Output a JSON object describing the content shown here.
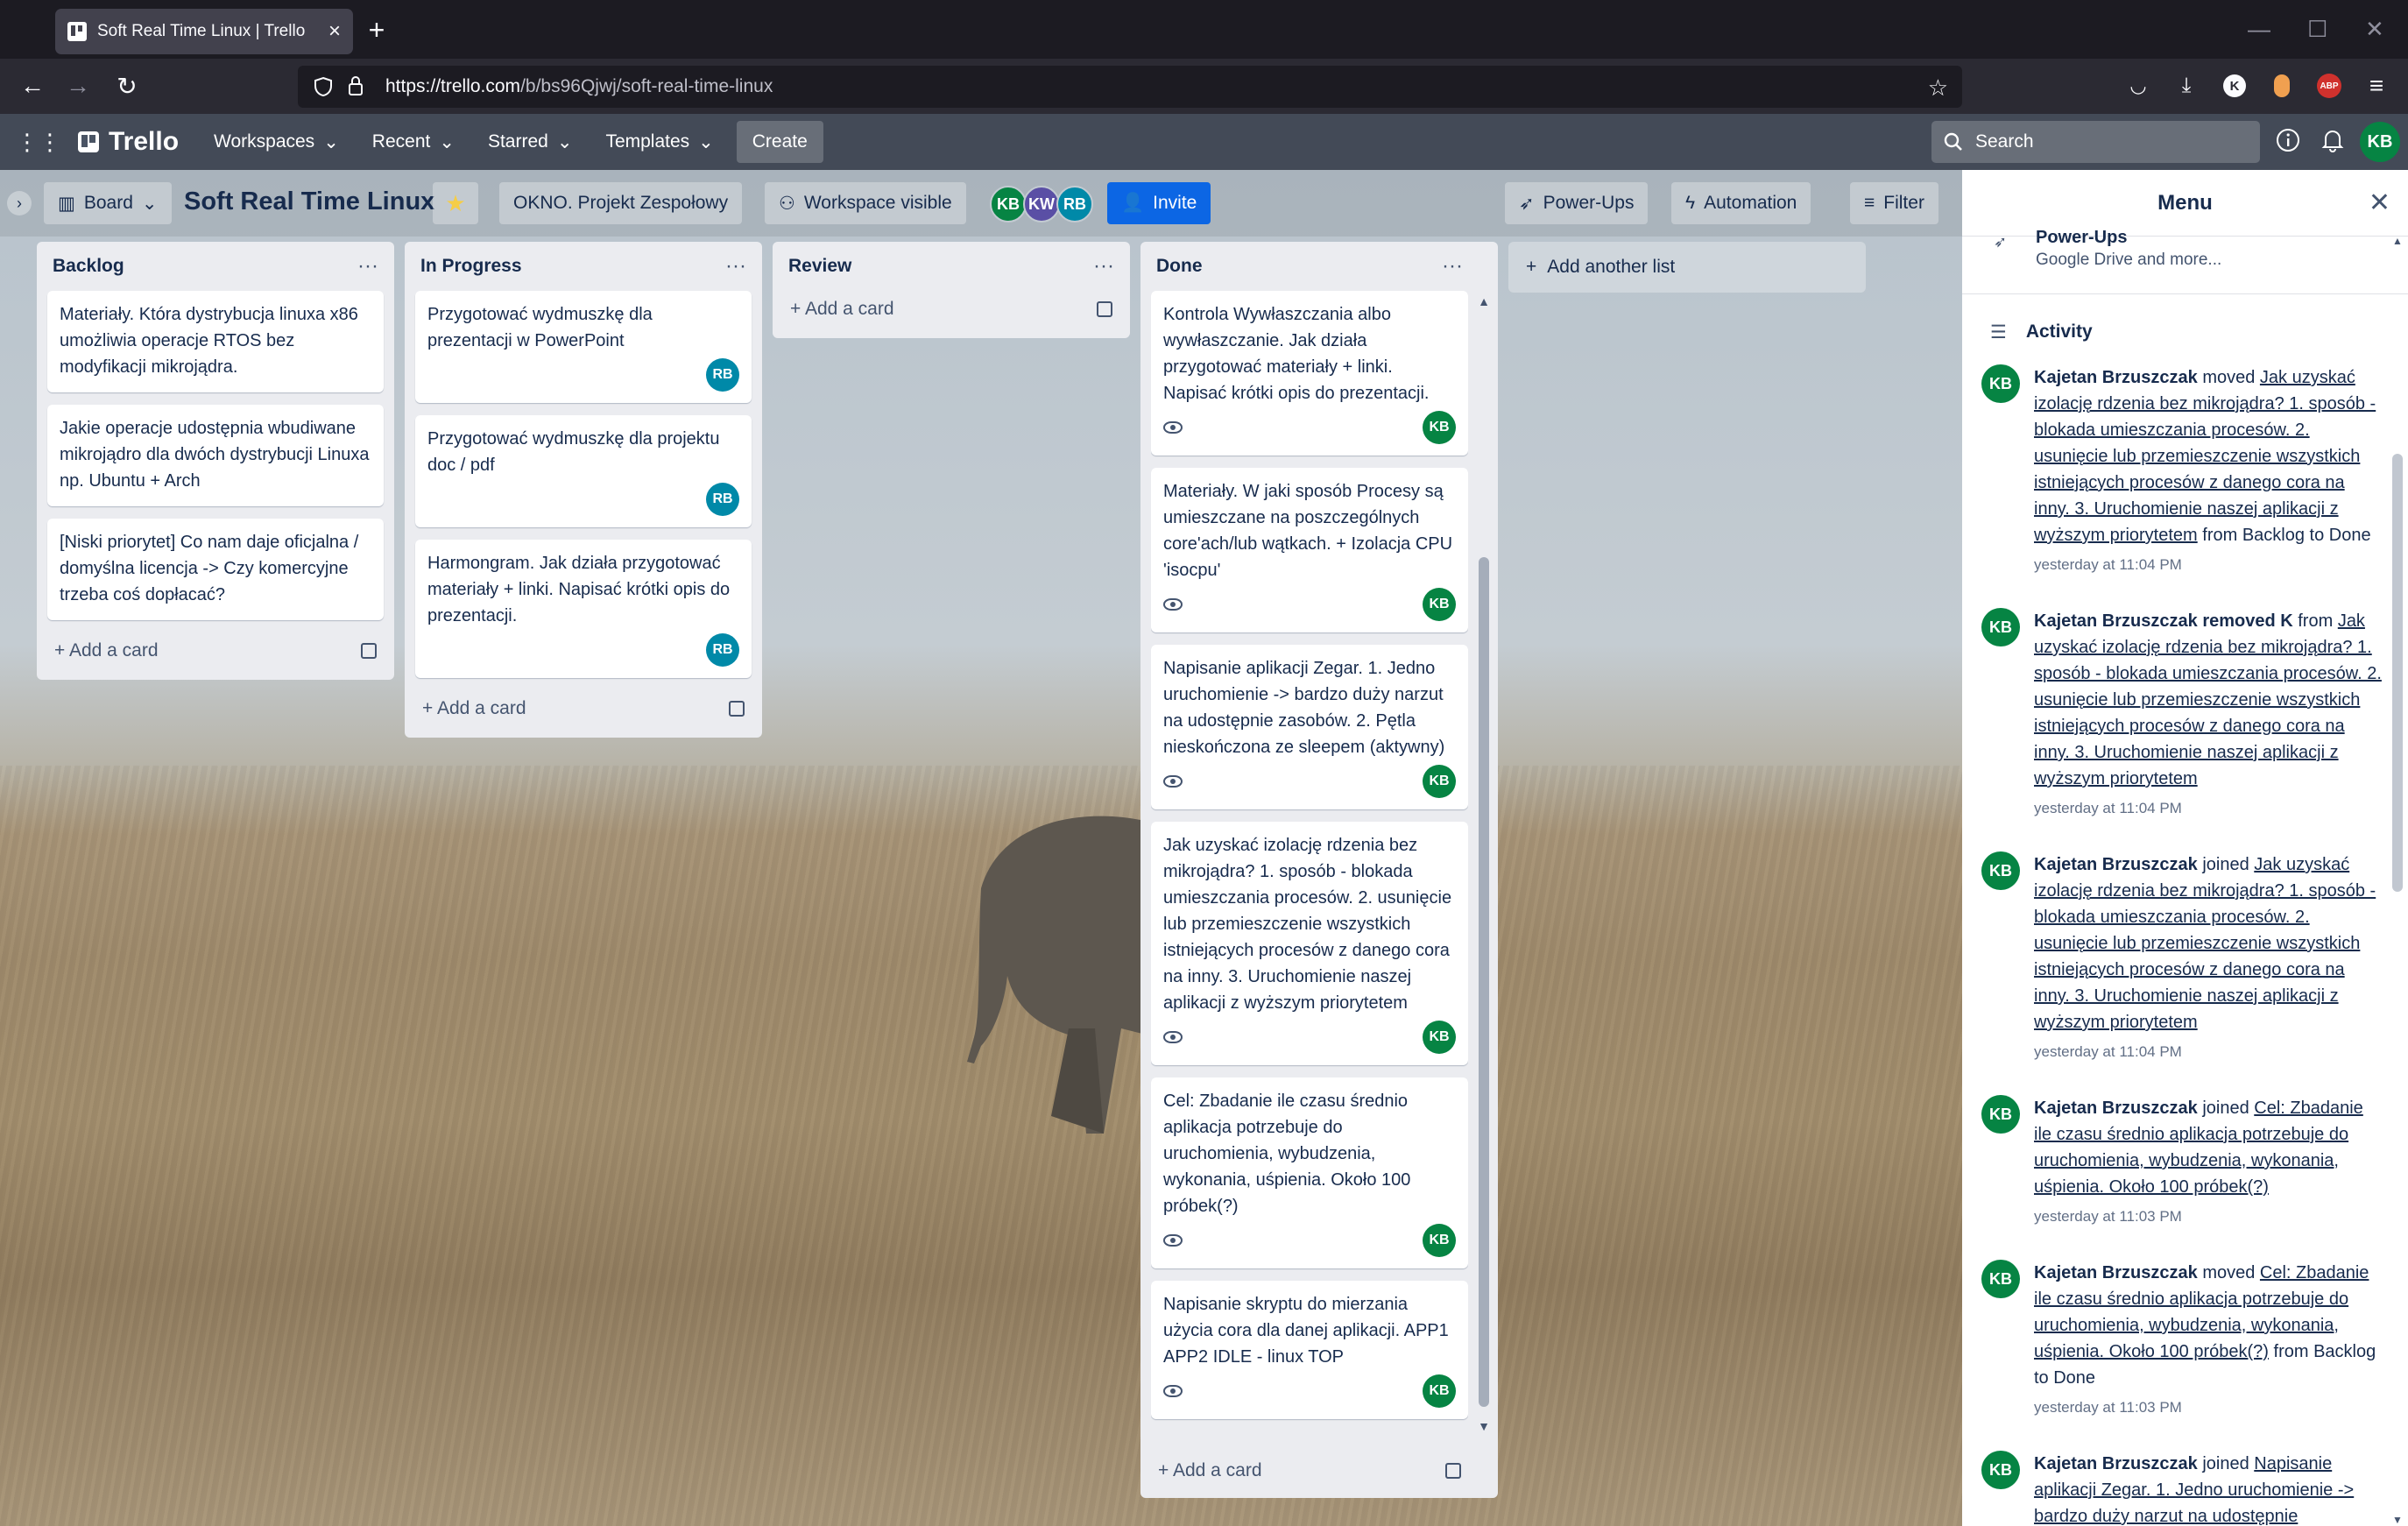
{
  "browser": {
    "tab_title": "Soft Real Time Linux | Trello",
    "url_host": "https://trello.com",
    "url_path": "/b/bs96Qjwj/soft-real-time-linux"
  },
  "header": {
    "logo": "Trello",
    "nav": [
      "Workspaces",
      "Recent",
      "Starred",
      "Templates"
    ],
    "create": "Create",
    "search_placeholder": "Search",
    "user_initials": "KB"
  },
  "board": {
    "view": "Board",
    "title": "Soft Real Time Linux",
    "workspace": "OKNO. Projekt Zespołowy",
    "visibility": "Workspace visible",
    "members": [
      "KB",
      "KW",
      "RB"
    ],
    "invite": "Invite",
    "powerups": "Power-Ups",
    "automation": "Automation",
    "filter": "Filter",
    "add_card": "Add a card",
    "add_list": "Add another list"
  },
  "lists": [
    {
      "name": "Backlog",
      "cards": [
        {
          "text": "Materiały. Która dystrybucja linuxa x86 umożliwia operacje RTOS bez modyfikacji mikrojądra."
        },
        {
          "text": "Jakie operacje udostępnia wbudiwane mikrojądro dla dwóch dystrybucji Linuxa np. Ubuntu + Arch"
        },
        {
          "text": "[Niski priorytet] Co nam daje oficjalna / domyślna licencja -> Czy komercyjne trzeba coś dopłacać?"
        }
      ]
    },
    {
      "name": "In Progress",
      "cards": [
        {
          "text": "Przygotować wydmuszkę dla prezentacji w PowerPoint",
          "member": "RB"
        },
        {
          "text": "Przygotować wydmuszkę dla projektu doc / pdf",
          "member": "RB"
        },
        {
          "text": "Harmongram. Jak działa przygotować materiały + linki. Napisać krótki opis do prezentacji.",
          "member": "RB"
        }
      ]
    },
    {
      "name": "Review",
      "cards": []
    },
    {
      "name": "Done",
      "cards": [
        {
          "text": "Kontrola Wywłaszczania albo wywłaszczanie. Jak działa przygotować materiały + linki. Napisać krótki opis do prezentacji.",
          "member": "KB"
        },
        {
          "text": "Materiały. W jaki sposób Procesy są umieszczane na poszczególnych core'ach/lub wątkach. + Izolacja CPU 'isocpu'",
          "member": "KB"
        },
        {
          "text": "Napisanie aplikacji Zegar. 1. Jedno uruchomienie -> bardzo duży narzut na udostępnie zasobów. 2. Pętla nieskończona ze sleepem (aktywny)",
          "member": "KB"
        },
        {
          "text": "Jak uzyskać izolację rdzenia bez mikrojądra? 1. sposób - blokada umieszczania procesów. 2. usunięcie lub przemieszczenie wszystkich istniejących procesów z danego cora na inny. 3. Uruchomienie naszej aplikacji z wyższym priorytetem",
          "member": "KB"
        },
        {
          "text": "Cel: Zbadanie ile czasu średnio aplikacja potrzebuje do uruchomienia, wybudzenia, wykonania, uśpienia. Około 100 próbek(?)",
          "member": "KB"
        },
        {
          "text": "Napisanie skryptu do mierzania użycia cora dla danej aplikacji. APP1 APP2 IDLE - linux TOP",
          "member": "KB"
        }
      ]
    }
  ],
  "menu": {
    "title": "Menu",
    "powerups_title": "Power-Ups",
    "powerups_sub": "Google Drive and more...",
    "activity_title": "Activity",
    "activities": [
      {
        "user": "Kajetan Brzuszczak",
        "action": "moved",
        "link": "Jak uzyskać izolację rdzenia bez mikrojądra? 1. sposób - blokada umieszczania procesów. 2. usunięcie lub przemieszczenie wszystkich istniejących procesów z danego cora na inny. 3. Uruchomienie naszej aplikacji z wyższym priorytetem",
        "tail": "from Backlog to Done",
        "time": "yesterday at 11:04 PM"
      },
      {
        "user": "Kajetan Brzuszczak",
        "action": "removed K",
        "link": "Jak uzyskać izolację rdzenia bez mikrojądra? 1. sposób - blokada umieszczania procesów. 2. usunięcie lub przemieszczenie wszystkich istniejących procesów z danego cora na inny. 3. Uruchomienie naszej aplikacji z wyższym priorytetem",
        "tail": "",
        "time": "yesterday at 11:04 PM"
      },
      {
        "user": "Kajetan Brzuszczak",
        "action": "joined",
        "link": "Jak uzyskać izolację rdzenia bez mikrojądra? 1. sposób - blokada umieszczania procesów. 2. usunięcie lub przemieszczenie wszystkich istniejących procesów z danego cora na inny. 3. Uruchomienie naszej aplikacji z wyższym priorytetem",
        "tail": "",
        "time": "yesterday at 11:04 PM"
      },
      {
        "user": "Kajetan Brzuszczak",
        "action": "joined",
        "link": "Cel: Zbadanie ile czasu średnio aplikacja potrzebuje do uruchomienia, wybudzenia, wykonania, uśpienia. Około 100 próbek(?)",
        "tail": "",
        "time": "yesterday at 11:03 PM"
      },
      {
        "user": "Kajetan Brzuszczak",
        "action": "moved",
        "link": "Cel: Zbadanie ile czasu średnio aplikacja potrzebuje do uruchomienia, wybudzenia, wykonania, uśpienia. Około 100 próbek(?)",
        "tail": "from Backlog to Done",
        "time": "yesterday at 11:03 PM"
      },
      {
        "user": "Kajetan Brzuszczak",
        "action": "joined",
        "link": "Napisanie aplikacji Zegar. 1. Jedno uruchomienie -> bardzo duży narzut na udostępnie",
        "tail": "",
        "time": ""
      }
    ]
  },
  "colors": {
    "kb": "#068443",
    "kw": "#5a4fa5",
    "rb": "#0089a8",
    "invite": "#0c66e4"
  }
}
